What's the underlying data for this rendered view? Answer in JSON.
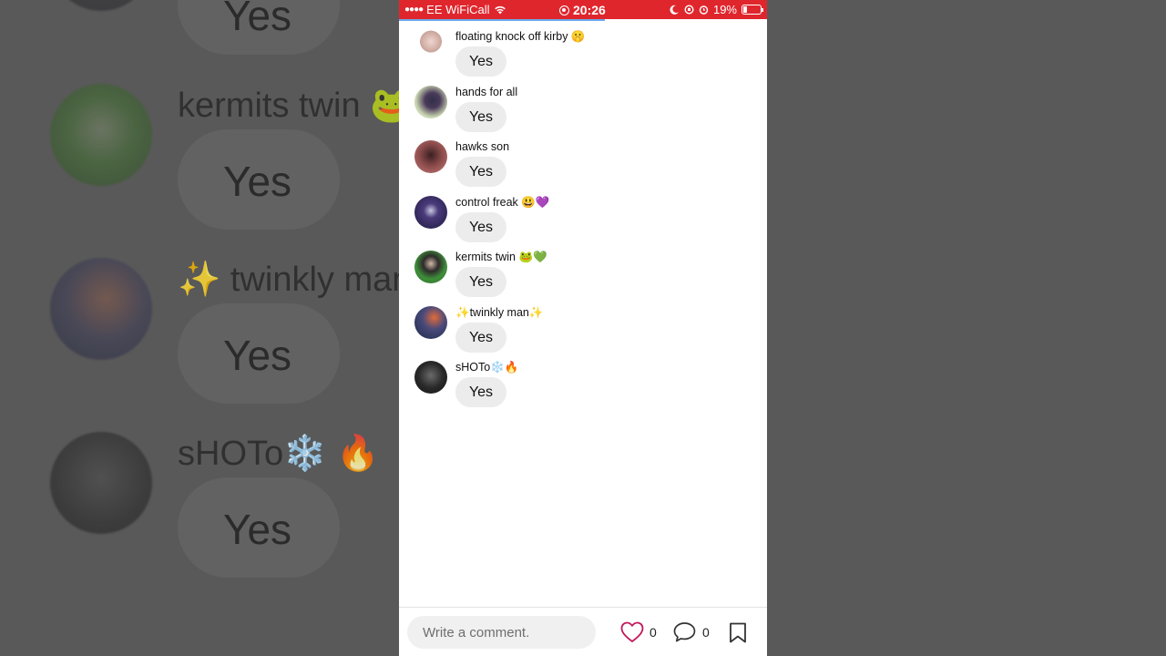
{
  "status_bar": {
    "carrier": "EE WiFiCall",
    "time": "20:26",
    "battery": "19%"
  },
  "colors": {
    "status_bar": "#e0262d",
    "progress": "#6aa9e9",
    "like_heart": "#c2185b"
  },
  "progress": {
    "fraction": 0.56
  },
  "messages": [
    {
      "user": "floating knock off kirby 🤫",
      "text": "Yes"
    },
    {
      "user": "hands for all",
      "text": "Yes"
    },
    {
      "user": "hawks son",
      "text": "Yes"
    },
    {
      "user": "control freak 😃💜",
      "text": "Yes"
    },
    {
      "user": "kermits twin 🐸💚",
      "text": "Yes"
    },
    {
      "user": "✨twinkly man✨",
      "text": "Yes"
    },
    {
      "user": "sHOTo❄️🔥",
      "text": "Yes"
    }
  ],
  "background_zoom": [
    {
      "user": "kermits twin 🐸",
      "text": "Yes"
    },
    {
      "user": "✨ twinkly man",
      "text": "Yes"
    },
    {
      "user": "sHOTo❄️ 🔥",
      "text": "Yes"
    }
  ],
  "bottom_bar": {
    "comment_placeholder": "Write a comment.",
    "likes": "0",
    "comments": "0",
    "icons": [
      "heart-icon",
      "comment-bubble-icon",
      "bookmark-icon"
    ]
  }
}
